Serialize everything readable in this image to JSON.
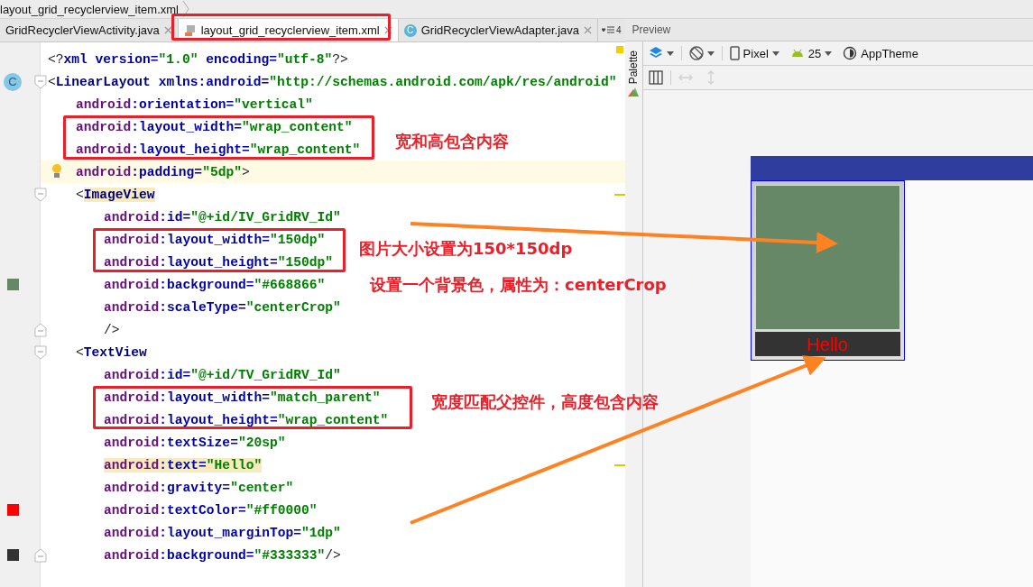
{
  "breadcrumb": {
    "label": "layout_grid_recyclerview_item.xml"
  },
  "tabs": [
    {
      "label": "GridRecyclerViewActivity.java",
      "selected": false,
      "kind": "plain"
    },
    {
      "label": "layout_grid_recyclerview_item.xml",
      "selected": true,
      "kind": "layout"
    },
    {
      "label": "GridRecyclerViewAdapter.java",
      "selected": false,
      "kind": "class",
      "icon_text": "C"
    }
  ],
  "tab_overflow": {
    "count": "4"
  },
  "editor": {
    "lines": [
      {
        "current": false,
        "tokens": [
          {
            "kind": "punct",
            "text": "<?"
          },
          {
            "kind": "tag",
            "text": "xml "
          },
          {
            "kind": "attr",
            "text": "version="
          },
          {
            "kind": "value",
            "text": "\"1.0\" "
          },
          {
            "kind": "attr",
            "text": "encoding="
          },
          {
            "kind": "value",
            "text": "\"utf-8\""
          },
          {
            "kind": "punct",
            "text": "?>"
          }
        ]
      },
      {
        "current": false,
        "gutter": [
          {
            "kind": "class",
            "text": "C"
          },
          {
            "kind": "fold-start"
          }
        ],
        "tokens": [
          {
            "kind": "punct",
            "text": "<"
          },
          {
            "kind": "tag",
            "text": "LinearLayout "
          },
          {
            "kind": "attr",
            "text": "xmlns:android="
          },
          {
            "kind": "value",
            "text": "\"http://schemas.android.com/apk/res/android\""
          }
        ],
        "children": [
          {
            "current": false,
            "tokens": [
              {
                "kind": "ns",
                "text": "android"
              },
              {
                "kind": "attr",
                "text": ":orientation="
              },
              {
                "kind": "value",
                "text": "\"vertical\""
              }
            ]
          },
          {
            "current": false,
            "tokens": [
              {
                "kind": "ns",
                "text": "android"
              },
              {
                "kind": "attr",
                "text": ":layout_width="
              },
              {
                "kind": "value",
                "text": "\"wrap_content\""
              }
            ]
          },
          {
            "current": false,
            "tokens": [
              {
                "kind": "ns",
                "text": "android"
              },
              {
                "kind": "attr",
                "text": ":layout_height="
              },
              {
                "kind": "value",
                "text": "\"wrap_content\""
              }
            ]
          },
          {
            "current": true,
            "hint": {
              "kind": "bulb"
            },
            "tokens": [
              {
                "kind": "ns",
                "text": "android"
              },
              {
                "kind": "attr",
                "text": ":padding="
              },
              {
                "kind": "value",
                "text": "\"5dp\""
              },
              {
                "kind": "punct",
                "text": ">"
              }
            ]
          },
          {
            "current": false,
            "gutter": [
              {
                "kind": "fold-start"
              }
            ],
            "tokens": [
              {
                "kind": "punct",
                "text": "<"
              },
              {
                "kind": "tag",
                "text": "ImageView",
                "highlight": true
              }
            ],
            "children": [
              {
                "current": false,
                "tokens": [
                  {
                    "kind": "ns",
                    "text": "android"
                  },
                  {
                    "kind": "attr",
                    "text": ":id="
                  },
                  {
                    "kind": "value",
                    "text": "\"@+id/IV_GridRV_Id\""
                  }
                ]
              },
              {
                "current": false,
                "tokens": [
                  {
                    "kind": "ns",
                    "text": "android"
                  },
                  {
                    "kind": "attr",
                    "text": ":layout_width="
                  },
                  {
                    "kind": "value",
                    "text": "\"150dp\""
                  }
                ]
              },
              {
                "current": false,
                "tokens": [
                  {
                    "kind": "ns",
                    "text": "android"
                  },
                  {
                    "kind": "attr",
                    "text": ":layout_height="
                  },
                  {
                    "kind": "value",
                    "text": "\"150dp\""
                  }
                ]
              },
              {
                "current": false,
                "gutter": [
                  {
                    "kind": "swatch",
                    "color": "#668866"
                  }
                ],
                "tokens": [
                  {
                    "kind": "ns",
                    "text": "android"
                  },
                  {
                    "kind": "attr",
                    "text": ":background="
                  },
                  {
                    "kind": "value",
                    "text": "\"#668866\""
                  }
                ]
              },
              {
                "current": false,
                "tokens": [
                  {
                    "kind": "ns",
                    "text": "android"
                  },
                  {
                    "kind": "attr",
                    "text": ":scaleType="
                  },
                  {
                    "kind": "value",
                    "text": "\"centerCrop\""
                  }
                ]
              },
              {
                "current": false,
                "gutter": [
                  {
                    "kind": "fold-end"
                  }
                ],
                "tokens": [
                  {
                    "kind": "punct",
                    "text": "/>"
                  }
                ]
              }
            ]
          },
          {
            "current": false,
            "gutter": [
              {
                "kind": "fold-start"
              }
            ],
            "tokens": [
              {
                "kind": "punct",
                "text": "<"
              },
              {
                "kind": "tag",
                "text": "TextView"
              }
            ],
            "children": [
              {
                "current": false,
                "tokens": [
                  {
                    "kind": "ns",
                    "text": "android"
                  },
                  {
                    "kind": "attr",
                    "text": ":id="
                  },
                  {
                    "kind": "value",
                    "text": "\"@+id/TV_GridRV_Id\""
                  }
                ]
              },
              {
                "current": false,
                "tokens": [
                  {
                    "kind": "ns",
                    "text": "android"
                  },
                  {
                    "kind": "attr",
                    "text": ":layout_width="
                  },
                  {
                    "kind": "value",
                    "text": "\"match_parent\""
                  }
                ]
              },
              {
                "current": false,
                "tokens": [
                  {
                    "kind": "ns",
                    "text": "android"
                  },
                  {
                    "kind": "attr",
                    "text": ":layout_height="
                  },
                  {
                    "kind": "value",
                    "text": "\"wrap_content\""
                  }
                ]
              },
              {
                "current": false,
                "tokens": [
                  {
                    "kind": "ns",
                    "text": "android"
                  },
                  {
                    "kind": "attr",
                    "text": ":textSize="
                  },
                  {
                    "kind": "value",
                    "text": "\"20sp\""
                  }
                ]
              },
              {
                "current": false,
                "tokens": [
                  {
                    "kind": "ns",
                    "text": "android",
                    "highlight": true
                  },
                  {
                    "kind": "attr",
                    "text": ":text=",
                    "highlight": true
                  },
                  {
                    "kind": "value",
                    "text": "\"Hello\"",
                    "highlight": true
                  }
                ]
              },
              {
                "current": false,
                "tokens": [
                  {
                    "kind": "ns",
                    "text": "android"
                  },
                  {
                    "kind": "attr",
                    "text": ":gravity="
                  },
                  {
                    "kind": "value",
                    "text": "\"center\""
                  }
                ]
              },
              {
                "current": false,
                "gutter": [
                  {
                    "kind": "swatch",
                    "color": "#ff0000"
                  }
                ],
                "tokens": [
                  {
                    "kind": "ns",
                    "text": "android"
                  },
                  {
                    "kind": "attr",
                    "text": ":textColor="
                  },
                  {
                    "kind": "value",
                    "text": "\"#ff0000\""
                  }
                ]
              },
              {
                "current": false,
                "tokens": [
                  {
                    "kind": "ns",
                    "text": "android"
                  },
                  {
                    "kind": "attr",
                    "text": ":layout_marginTop="
                  },
                  {
                    "kind": "value",
                    "text": "\"1dp\""
                  }
                ]
              },
              {
                "current": false,
                "gutter": [
                  {
                    "kind": "swatch",
                    "color": "#333333"
                  },
                  {
                    "kind": "fold-end"
                  }
                ],
                "tokens": [
                  {
                    "kind": "ns",
                    "text": "android"
                  },
                  {
                    "kind": "attr",
                    "text": ":background="
                  },
                  {
                    "kind": "value",
                    "text": "\"#333333\""
                  },
                  {
                    "kind": "punct",
                    "text": "/>"
                  }
                ]
              }
            ]
          }
        ]
      }
    ]
  },
  "annotations": {
    "notes": [
      "宽和高包含内容",
      "图片大小设置为150*150dp",
      "设置一个背景色，属性为：centerCrop",
      "宽度匹配父控件，高度包含内容"
    ]
  },
  "preview": {
    "title": "Preview",
    "palette_label": "Palette",
    "toolbar": [
      {
        "kind": "layers"
      },
      {
        "kind": "rotate"
      },
      {
        "kind": "device",
        "label": "Pixel"
      },
      {
        "kind": "api",
        "label": "25"
      },
      {
        "kind": "theme",
        "label": "AppTheme"
      }
    ],
    "toolbar2": [
      {
        "kind": "columns",
        "disabled": false
      },
      {
        "kind": "hresize",
        "disabled": true
      },
      {
        "kind": "vresize",
        "disabled": true
      }
    ],
    "item": {
      "image": {
        "color": "#668866"
      },
      "label_bar": {
        "color": "#333333"
      },
      "label": {
        "text": "Hello",
        "color": "#ff0000"
      }
    }
  }
}
